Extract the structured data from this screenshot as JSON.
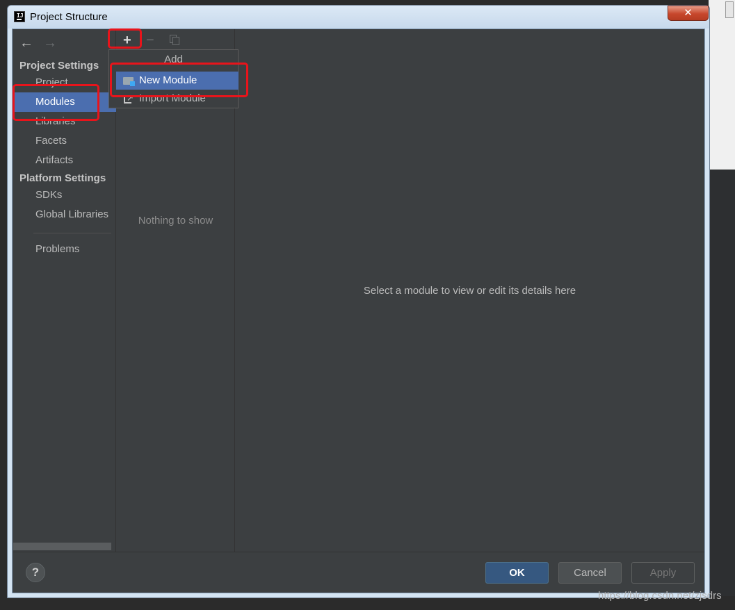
{
  "window": {
    "title": "Project Structure",
    "close_label": "✕"
  },
  "nav": {
    "back_icon": "←",
    "forward_icon": "→",
    "sections": [
      {
        "title": "Project Settings",
        "items": [
          {
            "label": "Project",
            "selected": false
          },
          {
            "label": "Modules",
            "selected": true
          },
          {
            "label": "Libraries",
            "selected": false
          },
          {
            "label": "Facets",
            "selected": false
          },
          {
            "label": "Artifacts",
            "selected": false
          }
        ]
      },
      {
        "title": "Platform Settings",
        "items": [
          {
            "label": "SDKs",
            "selected": false
          },
          {
            "label": "Global Libraries",
            "selected": false
          }
        ]
      }
    ],
    "problems_label": "Problems"
  },
  "toolbar": {
    "add_icon": "+",
    "remove_icon": "−"
  },
  "module_list": {
    "empty_text": "Nothing to show"
  },
  "detail": {
    "placeholder": "Select a module to view or edit its details here"
  },
  "add_popup": {
    "title": "Add",
    "items": [
      {
        "label": "New Module",
        "icon": "folder-module-icon",
        "selected": true
      },
      {
        "label": "Import Module",
        "icon": "import-icon",
        "selected": false
      }
    ]
  },
  "footer": {
    "help_label": "?",
    "ok_label": "OK",
    "cancel_label": "Cancel",
    "apply_label": "Apply"
  },
  "watermark": "https://blog.csdn.net/zjsdrs",
  "colors": {
    "selection": "#4b6eaf",
    "panel": "#3c3f41",
    "highlight": "#e8141b"
  }
}
